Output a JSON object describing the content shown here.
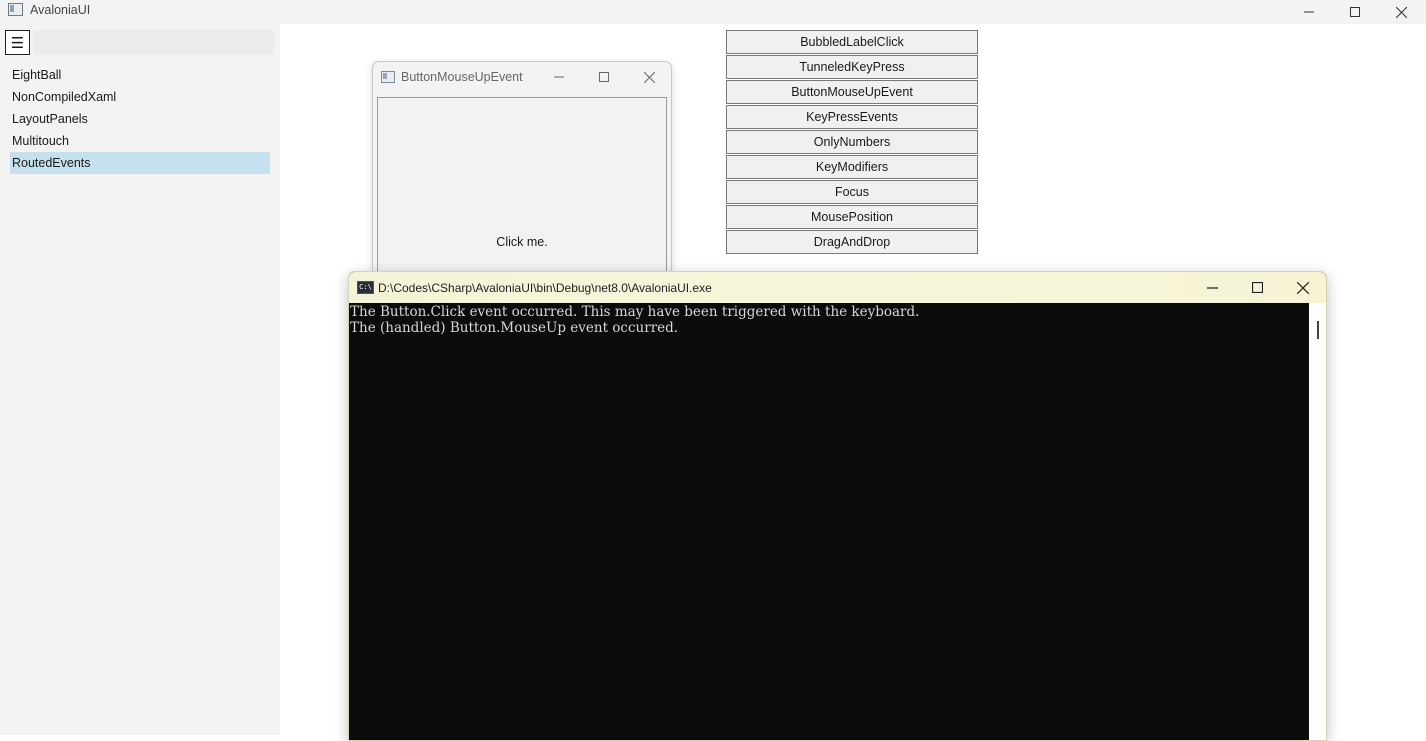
{
  "main_window": {
    "title": "AvaloniaUI",
    "icon": "app-window-icon"
  },
  "sidebar": {
    "menu_icon": "☰",
    "items": [
      {
        "label": "EightBall"
      },
      {
        "label": "NonCompiledXaml"
      },
      {
        "label": "LayoutPanels"
      },
      {
        "label": "Multitouch"
      },
      {
        "label": "RoutedEvents"
      }
    ],
    "selected": "RoutedEvents"
  },
  "event_buttons": [
    {
      "label": "BubbledLabelClick"
    },
    {
      "label": "TunneledKeyPress"
    },
    {
      "label": "ButtonMouseUpEvent"
    },
    {
      "label": "KeyPressEvents"
    },
    {
      "label": "OnlyNumbers"
    },
    {
      "label": "KeyModifiers"
    },
    {
      "label": "Focus"
    },
    {
      "label": "MousePosition"
    },
    {
      "label": "DragAndDrop"
    }
  ],
  "child_window": {
    "title": "ButtonMouseUpEvent",
    "button_label": "Click me."
  },
  "console_window": {
    "title": "D:\\Codes\\CSharp\\AvaloniaUI\\bin\\Debug\\net8.0\\AvaloniaUI.exe",
    "icon_text": "C:\\",
    "lines": [
      "The Button.Click event occurred. This may have been triggered with the keyboard.",
      "The (handled) Button.MouseUp event occurred."
    ]
  },
  "colors": {
    "selected_nav": "#c5e1ee",
    "console_bg": "#0c0c0c",
    "console_title_bg": "#f6f4d5"
  }
}
